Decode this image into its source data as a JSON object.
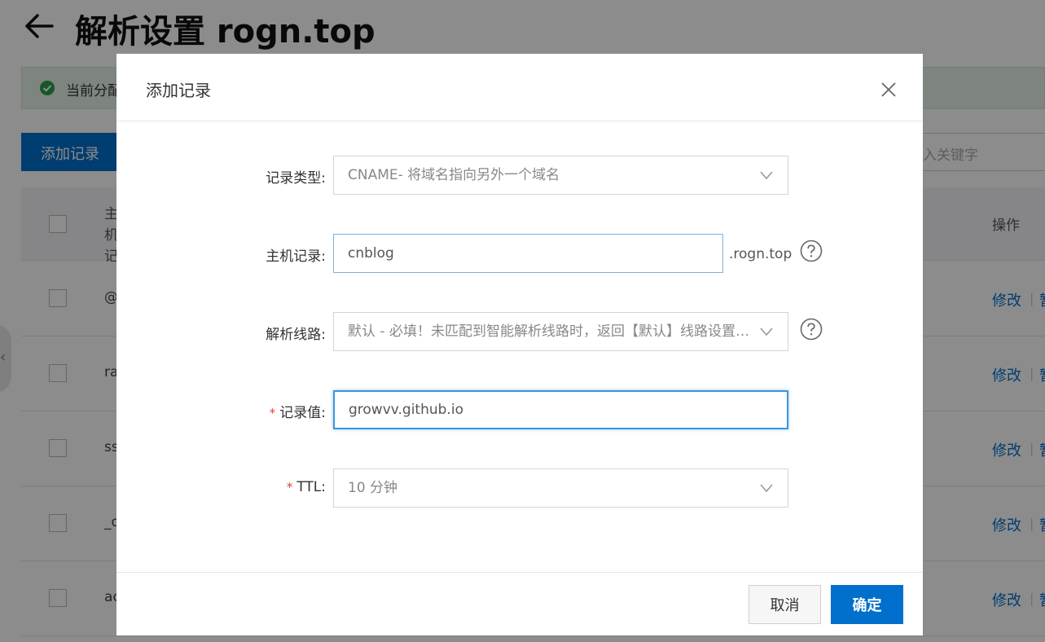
{
  "page": {
    "title": "解析设置 rogn.top",
    "notice_text": "当前分配",
    "add_record_button": "添加记录",
    "search_placeholder": "入关键字",
    "table": {
      "header_host": "主机记录",
      "header_op": "操作",
      "rows": [
        {
          "host": "@",
          "edit": "修改",
          "more": "暂"
        },
        {
          "host": "ra",
          "edit": "修改",
          "more": "暂"
        },
        {
          "host": "ss",
          "edit": "修改",
          "more": "暂"
        },
        {
          "host": "_d",
          "edit": "修改",
          "more": "暂"
        },
        {
          "host": "ac",
          "edit": "修改",
          "more": "暂"
        }
      ]
    }
  },
  "modal": {
    "title": "添加记录",
    "fields": {
      "record_type": {
        "label": "记录类型:",
        "value": "CNAME- 将域名指向另外一个域名"
      },
      "host": {
        "label": "主机记录:",
        "value": "cnblog",
        "suffix": ".rogn.top"
      },
      "line": {
        "label": "解析线路:",
        "value": "默认 - 必填！未匹配到智能解析线路时，返回【默认】线路设置结果"
      },
      "record_value": {
        "label": "记录值:",
        "value": "growvv.github.io",
        "required": "*"
      },
      "ttl": {
        "label": "TTL:",
        "value": "10 分钟",
        "required": "*"
      }
    },
    "cancel_label": "取消",
    "ok_label": "确定"
  },
  "colors": {
    "primary": "#0070cc",
    "required": "#e0423a",
    "focus_border": "#3a96dc",
    "success": "#2a9d4a"
  }
}
